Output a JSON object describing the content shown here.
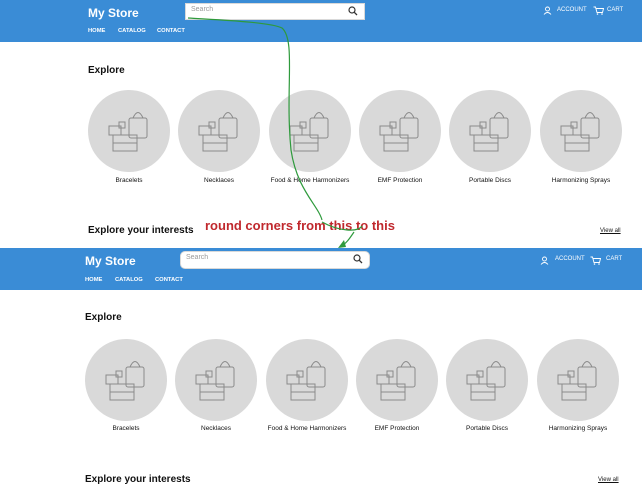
{
  "top": {
    "header": {
      "store_name": "My Store",
      "search_placeholder": "Search",
      "account_label": "ACCOUNT",
      "cart_label": "CART"
    },
    "nav": [
      "HOME",
      "CATALOG",
      "CONTACT"
    ],
    "explore_title": "Explore",
    "categories": [
      "Bracelets",
      "Necklaces",
      "Food & Home Harmonizers",
      "EMF Protection",
      "Portable Discs",
      "Harmonizing Sprays"
    ],
    "interests_title": "Explore your interests",
    "view_all": "View all"
  },
  "bottom": {
    "header": {
      "store_name": "My Store",
      "search_placeholder": "Search",
      "account_label": "ACCOUNT",
      "cart_label": "CART"
    },
    "nav": [
      "HOME",
      "CATALOG",
      "CONTACT"
    ],
    "explore_title": "Explore",
    "categories": [
      "Bracelets",
      "Necklaces",
      "Food & Home Harmonizers",
      "EMF Protection",
      "Portable Discs",
      "Harmonizing Sprays"
    ],
    "interests_title": "Explore your interests",
    "view_all": "View all"
  },
  "annotation": {
    "text": "round corners from this to this",
    "color": "#c0282d",
    "arrow_color": "#2e9a3c"
  },
  "colors": {
    "header_bg": "#3a8cd6",
    "placeholder_circle": "#d9d9d9"
  }
}
